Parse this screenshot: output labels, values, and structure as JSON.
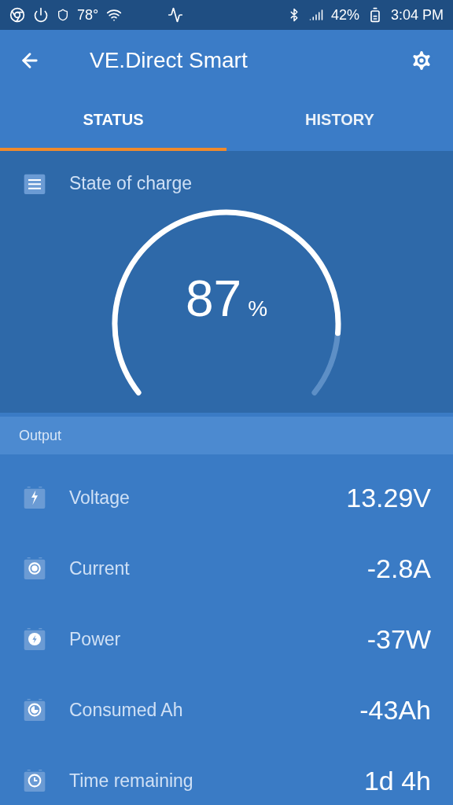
{
  "status_bar": {
    "temperature": "78°",
    "battery": "42%",
    "time": "3:04 PM"
  },
  "app_bar": {
    "title": "VE.Direct Smart"
  },
  "tabs": [
    {
      "label": "STATUS",
      "selected": true
    },
    {
      "label": "HISTORY",
      "selected": false
    }
  ],
  "state_of_charge": {
    "label": "State of charge",
    "value": "87",
    "unit": "%"
  },
  "section": {
    "title": "Output"
  },
  "rows": [
    {
      "kind": "voltage",
      "label": "Voltage",
      "value": "13.29V"
    },
    {
      "kind": "current",
      "label": "Current",
      "value": "-2.8A"
    },
    {
      "kind": "power",
      "label": "Power",
      "value": "-37W"
    },
    {
      "kind": "consumed",
      "label": "Consumed Ah",
      "value": "-43Ah"
    },
    {
      "kind": "time",
      "label": "Time remaining",
      "value": "1d 4h"
    }
  ]
}
